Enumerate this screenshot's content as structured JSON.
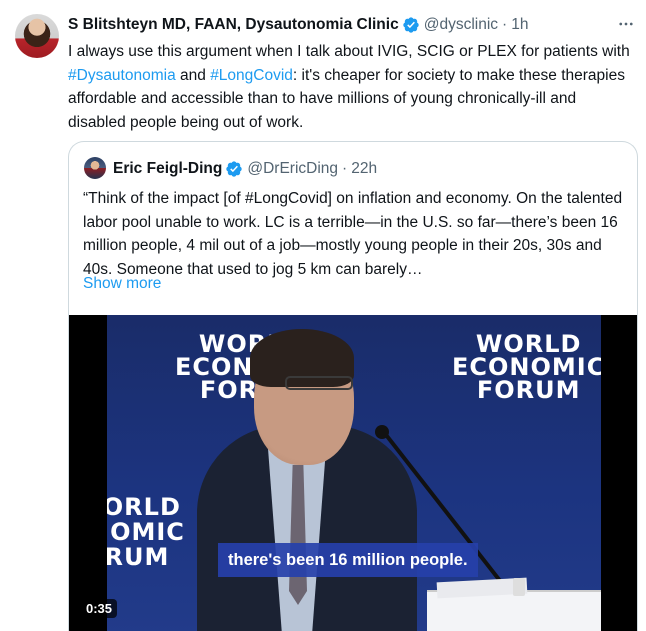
{
  "tweet": {
    "author_name": "S Blitshteyn MD, FAAN, Dysautonomia Clinic",
    "handle": "@dysclinic",
    "separator": "·",
    "time": "1h",
    "more_icon": "more-horizontal-icon",
    "text_part1": "I always use this argument when I talk about IVIG, SCIG or PLEX for patients with ",
    "hashtag1": "#Dysautonomia",
    "text_part2": " and ",
    "hashtag2": "#LongCovid",
    "text_part3": ": it's cheaper for society to make these therapies affordable and accessible than to have millions of young chronically-ill and disabled people being out of work."
  },
  "quote": {
    "author_name": "Eric Feigl-Ding",
    "handle": "@DrEricDing",
    "separator": "·",
    "time": "22h",
    "text": "“Think of the impact [of #LongCovid] on inflation and economy. On the talented labor pool unable to work. LC is a terrible—in the U.S. so far—there’s been 16 million people, 4 mil out of a job—mostly young people in their 20s, 30s and 40s. Someone that used to jog 5 km can barely…",
    "show_more": "Show more"
  },
  "video": {
    "logo_left": [
      "WORLD",
      "ECONOMIC",
      "FORUM"
    ],
    "logo_right": [
      "WORLD",
      "ECONOMIC",
      "FORUM"
    ],
    "logo_bottom": [
      "WORLD",
      "ECONOMIC",
      "FORUM"
    ],
    "logo_bottom_visible": [
      "/ORLD",
      "NOMIC",
      "RUM"
    ],
    "caption": "there's been 16 million people.",
    "duration": "0:35"
  },
  "colors": {
    "link": "#1d9bf0",
    "verified": "#1d9bf0",
    "muted": "#536471",
    "stage_blue": "#1c3480",
    "caption_bg": "#2640aa"
  }
}
